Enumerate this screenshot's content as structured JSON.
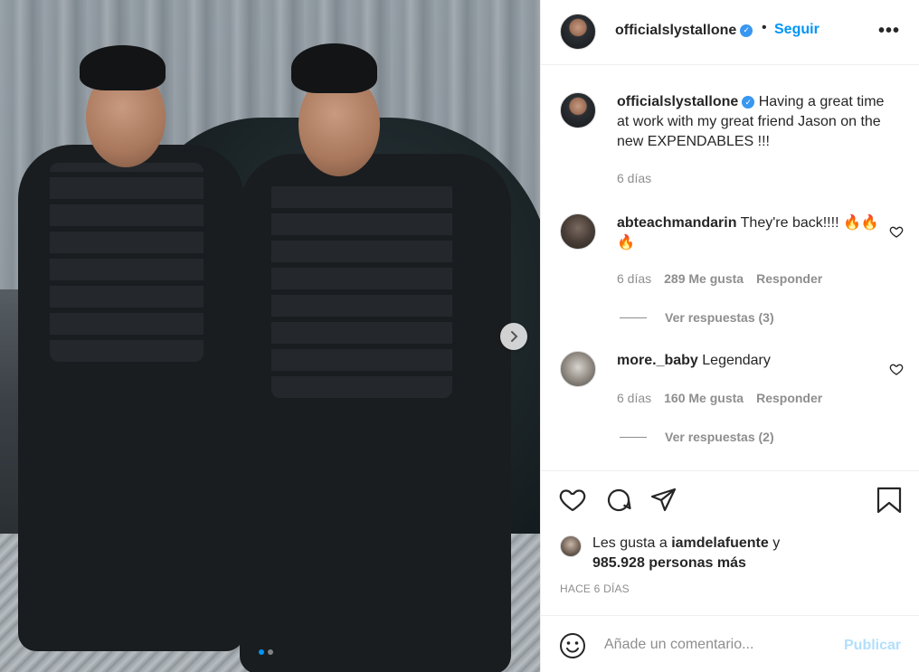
{
  "photo": {
    "alt_icon": "photo",
    "carousel_dots": 2,
    "active_dot_index": 0,
    "next_icon": "chevron-right-icon"
  },
  "header": {
    "username": "officialslystallone",
    "separator": "•",
    "follow_label": "Seguir",
    "more_label": "•••"
  },
  "caption": {
    "username": "officialslystallone",
    "text": "Having a great time at work with my great friend Jason on the new EXPENDABLES !!!",
    "age": "6 días"
  },
  "comments": [
    {
      "username": "abteachmandarin",
      "text": "They're back!!!! 🔥🔥🔥",
      "age": "6 días",
      "likes": "289 Me gusta",
      "reply_label": "Responder",
      "view_replies": "Ver respuestas (3)"
    },
    {
      "username": "more._baby",
      "text": "Legendary",
      "age": "6 días",
      "likes": "160 Me gusta",
      "reply_label": "Responder",
      "view_replies": "Ver respuestas (2)"
    }
  ],
  "likes": {
    "prefix": "Les gusta a",
    "user": "iamdelafuente",
    "middle": "y",
    "others": "985.928 personas más"
  },
  "posted": "HACE 6 DÍAS",
  "add_comment": {
    "placeholder": "Añade un comentario...",
    "publish_label": "Publicar"
  },
  "colors": {
    "accent": "#0095f6",
    "verified": "#3897f0",
    "muted": "#8e8e8e",
    "publish_disabled": "#b2dffc",
    "text": "#262626"
  }
}
